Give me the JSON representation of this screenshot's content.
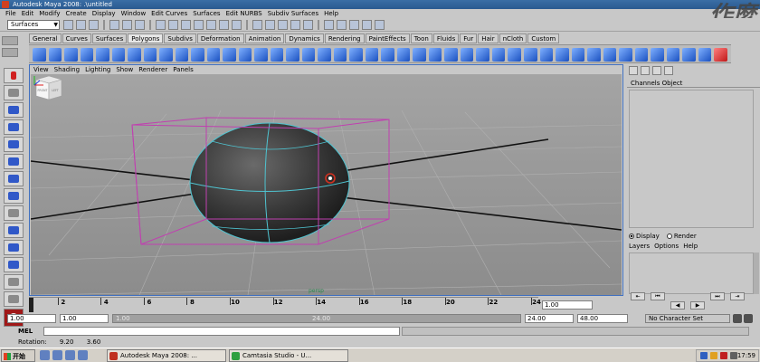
{
  "window": {
    "title": "Autodesk Maya 2008: .\\untitled"
  },
  "watermark": "作麼",
  "menubar": [
    "File",
    "Edit",
    "Modify",
    "Create",
    "Display",
    "Window",
    "Edit Curves",
    "Surfaces",
    "Edit NURBS",
    "Subdiv Surfaces",
    "Help"
  ],
  "status_line": {
    "mode": "Surfaces"
  },
  "shelf": {
    "tabs": [
      "General",
      "Curves",
      "Surfaces",
      "Polygons",
      "Subdivs",
      "Deformation",
      "Animation",
      "Dynamics",
      "Rendering",
      "PaintEffects",
      "Toon",
      "Fluids",
      "Fur",
      "Hair",
      "nCloth",
      "Custom"
    ],
    "active_tab": "Polygons"
  },
  "panel": {
    "menu": [
      "View",
      "Shading",
      "Lighting",
      "Show",
      "Renderer",
      "Panels"
    ],
    "camera": "persp",
    "viewcube": {
      "front": "FRONT",
      "right": "LEFT"
    }
  },
  "channel_box": {
    "menu": [
      "Channels",
      "Object"
    ]
  },
  "layer_editor": {
    "display_option": "Display",
    "render_option": "Render",
    "menu": [
      "Layers",
      "Options",
      "Help"
    ]
  },
  "time_slider": {
    "ticks": [
      2,
      4,
      6,
      8,
      10,
      12,
      14,
      16,
      18,
      20,
      22,
      24
    ],
    "current_frame": "1.00"
  },
  "playback_buttons": [
    "⇤",
    "⏮",
    "◀",
    "▶",
    "⏭",
    "⇥"
  ],
  "range_slider": {
    "start_time": "1.00",
    "playback_start": "1.00",
    "range_left": "1.00",
    "range_right": "24.00",
    "playback_end": "24.00",
    "end_time": "48.00",
    "character_set": "No Character Set"
  },
  "command_line": {
    "label": "MEL"
  },
  "help_line": {
    "label": "Rotation:",
    "x": "9.20",
    "y": "3.60"
  },
  "taskbar": {
    "start": "开始",
    "tasks": [
      "Autodesk Maya 2008: ...",
      "Camtasia Studio - U..."
    ],
    "clock": "17:59"
  },
  "colors": {
    "selection_box": "#c040b0",
    "wire": "#4fc3d0",
    "grid_axis": "#101010"
  }
}
